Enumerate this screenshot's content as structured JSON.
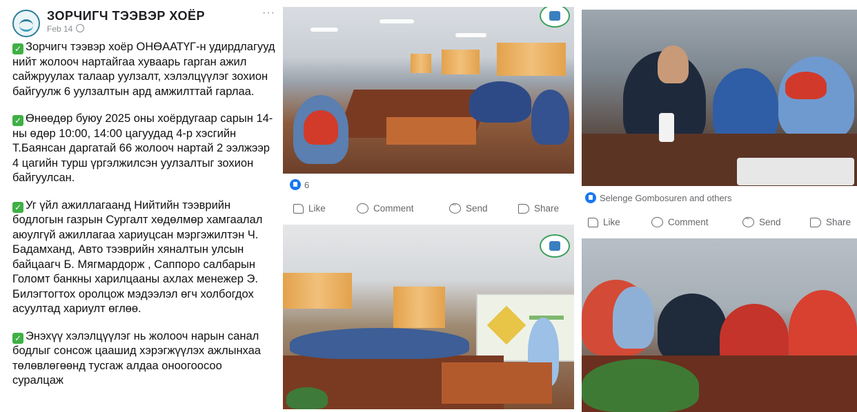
{
  "post": {
    "page_name": "ЗОРЧИГЧ ТЭЭВЭР ХОЁР",
    "date": "Feb 14",
    "more": "···",
    "paragraphs": [
      "Зорчигч тээвэр хоёр ОНӨААТҮГ-н удирдлагууд нийт жолооч нартайгаа хуваарь гарган ажил сайжруулах талаар уулзалт, хэлэлцүүлэг зохион байгуулж 6 уулзалтын ард амжилттай гарлаа.",
      "Өнөөдөр буюу 2025 оны хоёрдугаар сарын 14-ны өдөр   10:00, 14:00 цагуудад 4-р хэсгийн Т.Баянсан даргатай 66 жолооч нартай 2 ээлжээр 4 цагийн турш үргэлжилсэн уулзалтыг зохион байгуулсан.",
      "Уг үйл ажиллагаанд Нийтийн тээврийн бодлогын газрын  Сургалт хөдөлмөр хамгаалал аюулгүй ажиллагаа хариуцсан мэргэжилтэн Ч. Бадамханд, Авто тээврийн хяналтын улсын байцаагч Б. Мягмардорж , Саппоро салбарын Голомт банкны  харилцааны ахлах менежер Э. Билэгтогтох оролцож мэдээлэл өгч холбогдох асуултад хариулт өглөө.",
      "Энэхүү хэлэлцүүлэг нь жолооч нарын санал бодлыг сонсож цаашид хэрэгжүүлэх ажлынхаа төлөвлөгөөнд тусгаж алдаа оноогоосоо суралцаж"
    ]
  },
  "middle": {
    "reaction_count": "6",
    "like_label": "Like",
    "comment_label": "Comment",
    "send_label": "Send",
    "share_label": "Share"
  },
  "right": {
    "reactions_text": "Selenge Gombosuren and others",
    "like_label": "Like",
    "comment_label": "Comment",
    "send_label": "Send",
    "share_label": "Share"
  },
  "colors": {
    "facebook_blue": "#1877f2",
    "check_green": "#3fb045",
    "muted_text": "#65676b"
  },
  "icons": [
    "page-logo-icon",
    "globe-icon",
    "check-icon",
    "like-reaction-icon",
    "like-icon",
    "comment-icon",
    "send-icon",
    "share-icon"
  ]
}
